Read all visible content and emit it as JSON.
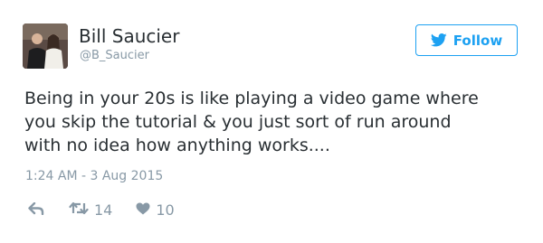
{
  "user": {
    "name": "Bill Saucier",
    "handle": "@B_Saucier"
  },
  "follow_button": {
    "label": "Follow",
    "icon": "twitter-bird-icon"
  },
  "tweet": {
    "lines": [
      "Being in your 20s is like playing a video game where",
      "you skip the tutorial & you just sort of run around",
      "with no idea how anything works...."
    ],
    "timestamp": "1:24 AM - 3 Aug 2015"
  },
  "actions": {
    "reply_icon": "reply-icon",
    "retweet_icon": "retweet-icon",
    "retweet_count": "14",
    "like_icon": "heart-icon",
    "like_count": "10"
  },
  "colors": {
    "accent": "#1da1f2",
    "text": "#292f33",
    "muted": "#8899a6"
  }
}
